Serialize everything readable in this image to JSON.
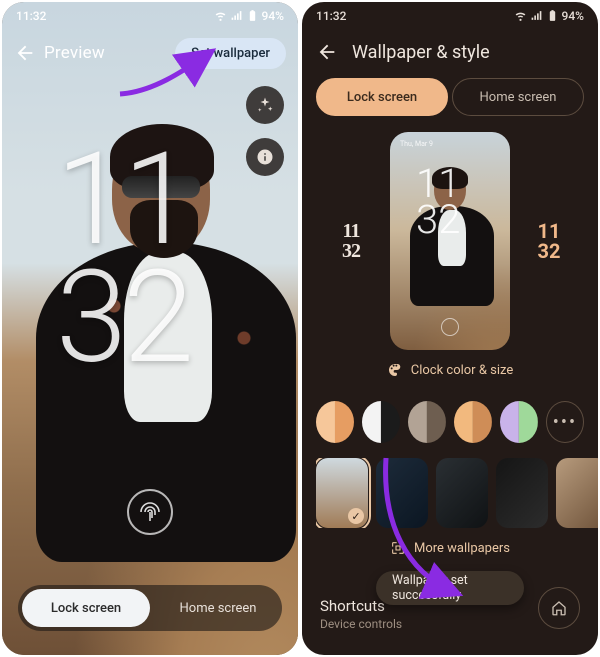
{
  "status": {
    "time": "11:32",
    "battery": "94%"
  },
  "arrow_color": "#8a2be2",
  "left": {
    "title": "Preview",
    "set_wallpaper": "Set wallpaper",
    "clock_hh": "11",
    "clock_mm": "32",
    "tab_lock": "Lock screen",
    "tab_home": "Home screen",
    "side_icons": [
      "sparkle-icon",
      "info-icon"
    ]
  },
  "right": {
    "title": "Wallpaper & style",
    "seg_lock": "Lock screen",
    "seg_home": "Home screen",
    "mini_date": "Thu, Mar 9",
    "mini_hh": "11",
    "mini_mm": "32",
    "sample_hh": "11",
    "sample_mm": "32",
    "clock_color_label": "Clock color & size",
    "more_wallpapers": "More wallpapers",
    "shortcuts_title": "Shortcuts",
    "shortcuts_sub": "Device controls",
    "toast": "Wallpaper set successfully",
    "swatch_colors": [
      {
        "l": "#f6c79a",
        "r": "#e69d62",
        "selected": true
      },
      {
        "l": "#f3f3f3",
        "r": "#1b1b1b",
        "selected": false
      },
      {
        "l": "#b2a395",
        "r": "#6e5e50",
        "selected": false
      },
      {
        "l": "#f2b97e",
        "r": "#cf8d57",
        "selected": false
      },
      {
        "l": "#c9b3ea",
        "r": "#9fd99a",
        "selected": false
      }
    ],
    "thumbs": [
      {
        "bg": "linear-gradient(#cfd9df,#a07b56)",
        "selected": true
      },
      {
        "bg": "linear-gradient(135deg,#1d2b3a,#0b1622)",
        "selected": false
      },
      {
        "bg": "linear-gradient(135deg,#2a2f33,#0f1214)",
        "selected": false
      },
      {
        "bg": "linear-gradient(135deg,#151515,#2c2c2c)",
        "selected": false
      },
      {
        "bg": "linear-gradient(135deg,#b79b7d,#6e5239)",
        "selected": false
      }
    ]
  }
}
